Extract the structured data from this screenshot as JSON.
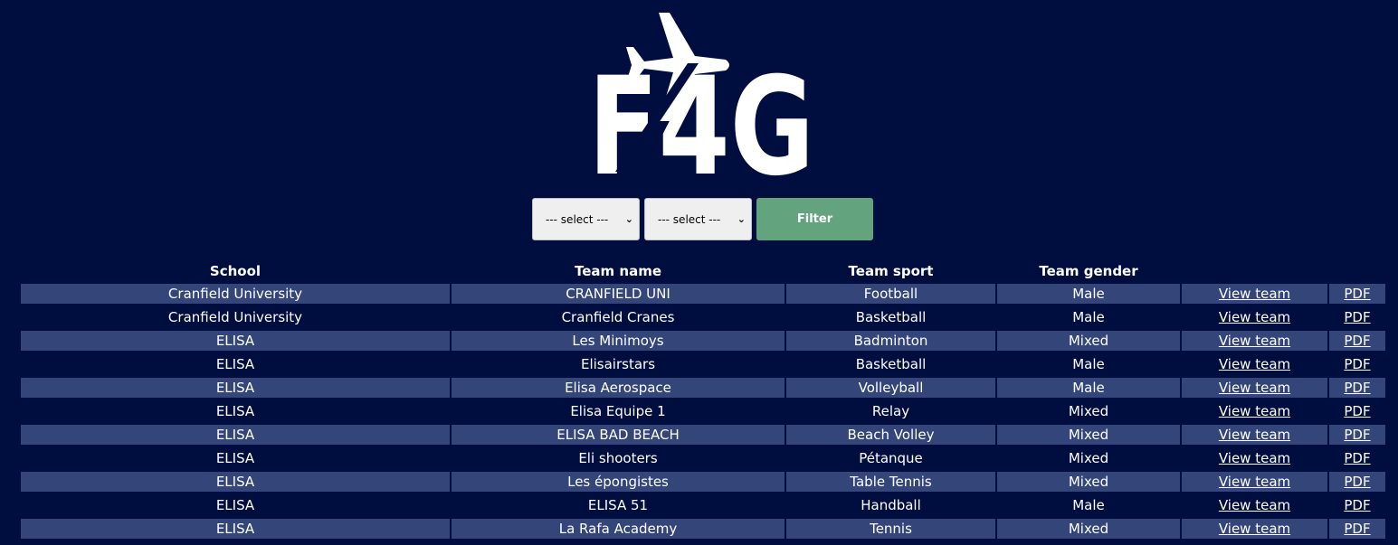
{
  "logo": {
    "text": "F4G"
  },
  "filters": {
    "select1_value": "--- select ---",
    "select2_value": "--- select ---",
    "button_label": "Filter"
  },
  "table": {
    "headers": [
      "School",
      "Team name",
      "Team sport",
      "Team gender",
      "",
      ""
    ],
    "rows": [
      {
        "school": "Cranfield University",
        "team": "CRANFIELD UNI",
        "sport": "Football",
        "gender": "Male",
        "view": "View team",
        "pdf": "PDF"
      },
      {
        "school": "Cranfield University",
        "team": "Cranfield Cranes",
        "sport": "Basketball",
        "gender": "Male",
        "view": "View team",
        "pdf": "PDF"
      },
      {
        "school": "ELISA",
        "team": "Les Minimoys",
        "sport": "Badminton",
        "gender": "Mixed",
        "view": "View team",
        "pdf": "PDF"
      },
      {
        "school": "ELISA",
        "team": "Elisairstars",
        "sport": "Basketball",
        "gender": "Male",
        "view": "View team",
        "pdf": "PDF"
      },
      {
        "school": "ELISA",
        "team": "Elisa Aerospace",
        "sport": "Volleyball",
        "gender": "Male",
        "view": "View team",
        "pdf": "PDF"
      },
      {
        "school": "ELISA",
        "team": "Elisa Equipe 1",
        "sport": "Relay",
        "gender": "Mixed",
        "view": "View team",
        "pdf": "PDF"
      },
      {
        "school": "ELISA",
        "team": "ELISA BAD BEACH",
        "sport": "Beach Volley",
        "gender": "Mixed",
        "view": "View team",
        "pdf": "PDF"
      },
      {
        "school": "ELISA",
        "team": "Eli shooters",
        "sport": "Pétanque",
        "gender": "Mixed",
        "view": "View team",
        "pdf": "PDF"
      },
      {
        "school": "ELISA",
        "team": "Les épongistes",
        "sport": "Table Tennis",
        "gender": "Mixed",
        "view": "View team",
        "pdf": "PDF"
      },
      {
        "school": "ELISA",
        "team": "ELISA 51",
        "sport": "Handball",
        "gender": "Male",
        "view": "View team",
        "pdf": "PDF"
      },
      {
        "school": "ELISA",
        "team": "La Rafa Academy",
        "sport": "Tennis",
        "gender": "Mixed",
        "view": "View team",
        "pdf": "PDF"
      }
    ]
  },
  "colors": {
    "background": "#000e3f",
    "row_stripe": "#34457a",
    "filter_button": "#63a37d"
  }
}
